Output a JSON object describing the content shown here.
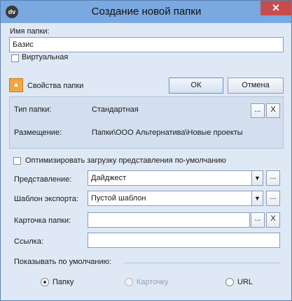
{
  "window": {
    "icon_text": "dv",
    "title": "Создание новой папки",
    "close_glyph": "✕"
  },
  "folder": {
    "name_label": "Имя папки:",
    "name_value": "Базис",
    "virtual_label": "Виртуальная",
    "virtual_checked": false
  },
  "properties": {
    "toggle_glyph": "▲",
    "header": "Свойства папки",
    "type_label": "Тип папки:",
    "type_value": "Стандартная",
    "location_label": "Размещение:",
    "location_value": "Папки\\ООО Альтернатива\\Новые проекты",
    "browse_glyph": "...",
    "clear_glyph": "X"
  },
  "buttons": {
    "ok": "ОК",
    "cancel": "Отмена"
  },
  "options": {
    "optimize_label": "Оптимизировать загрузку представления по-умолчанию",
    "optimize_checked": false,
    "view_label": "Представление:",
    "view_value": "Дайджест",
    "export_label": "Шаблон экспорта:",
    "export_value": "Пустой шаблон",
    "card_label": "Карточка папки:",
    "card_value": "",
    "link_label": "Ссылка:",
    "link_value": "",
    "arrow_glyph": "▼"
  },
  "default_view": {
    "label": "Показывать по умолчанию:",
    "radios": [
      {
        "label": "Папку",
        "checked": true,
        "disabled": false
      },
      {
        "label": "Карточку",
        "checked": false,
        "disabled": true
      },
      {
        "label": "URL",
        "checked": false,
        "disabled": false
      }
    ]
  }
}
